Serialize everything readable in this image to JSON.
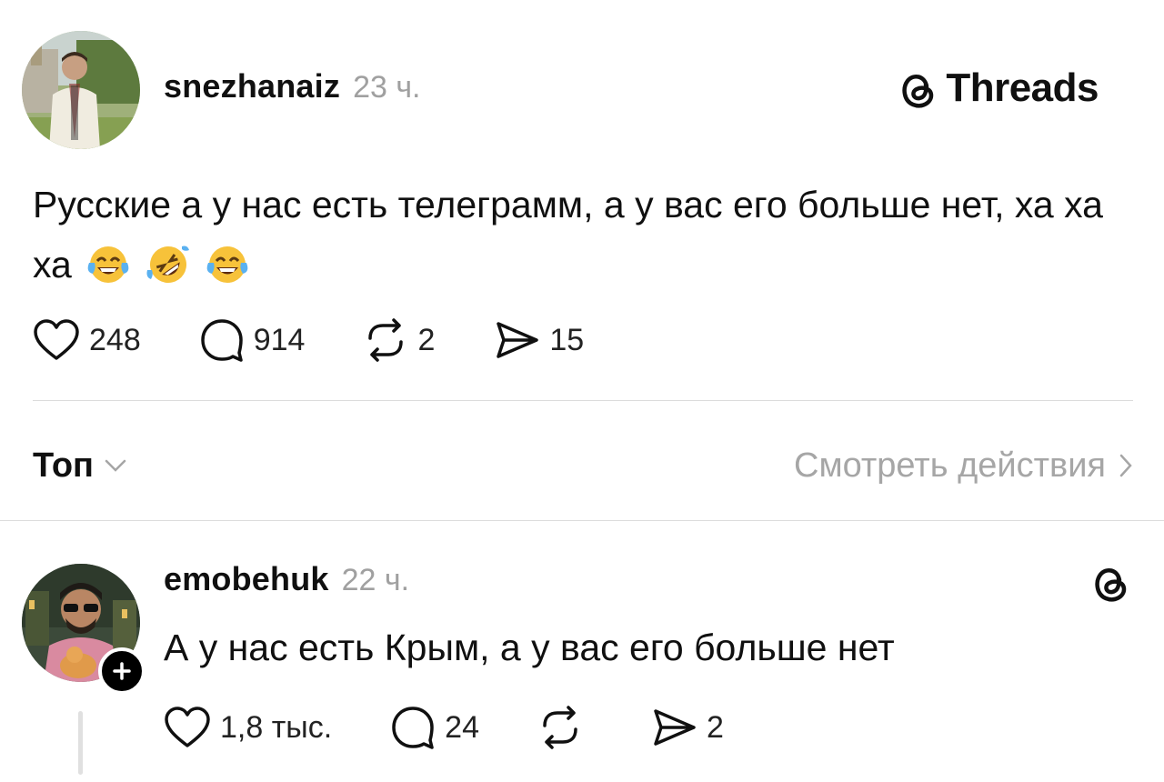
{
  "brand": {
    "name": "Threads",
    "icon": "threads-logo-icon"
  },
  "post": {
    "username": "snezhanaiz",
    "time": "23 ч.",
    "text": "Русские а у нас есть телеграмм, а у вас его больше нет, ха ха ха",
    "emojis": [
      "face-with-tears-of-joy",
      "rolling-on-floor-laughing",
      "face-with-tears-of-joy"
    ],
    "stats": {
      "likes": "248",
      "comments": "914",
      "reposts": "2",
      "shares": "15"
    }
  },
  "sort": {
    "label": "Топ",
    "activity_link": "Смотреть действия"
  },
  "reply": {
    "username": "emobehuk",
    "time": "22 ч.",
    "text": "А у нас есть Крым, а у вас его больше нет",
    "stats": {
      "likes": "1,8 тыс.",
      "comments": "24",
      "reposts": "",
      "shares": "2"
    }
  },
  "colors": {
    "text": "#101010",
    "muted": "#a0a0a0",
    "divider": "#dcdcdc",
    "background": "#ffffff"
  }
}
